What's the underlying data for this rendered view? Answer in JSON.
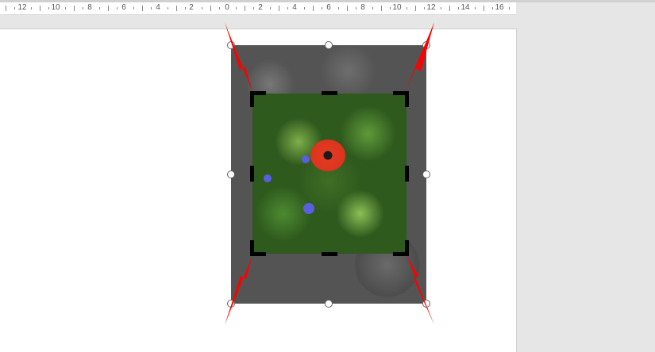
{
  "ruler": {
    "labels": [
      "12",
      "10",
      "8",
      "6",
      "4",
      "2",
      "0",
      "2",
      "4",
      "6",
      "8",
      "10",
      "12",
      "14",
      "16"
    ]
  },
  "colors": {
    "arrow": "#ff0000",
    "crop_mark": "#000000",
    "cropped_region": "#545454"
  }
}
